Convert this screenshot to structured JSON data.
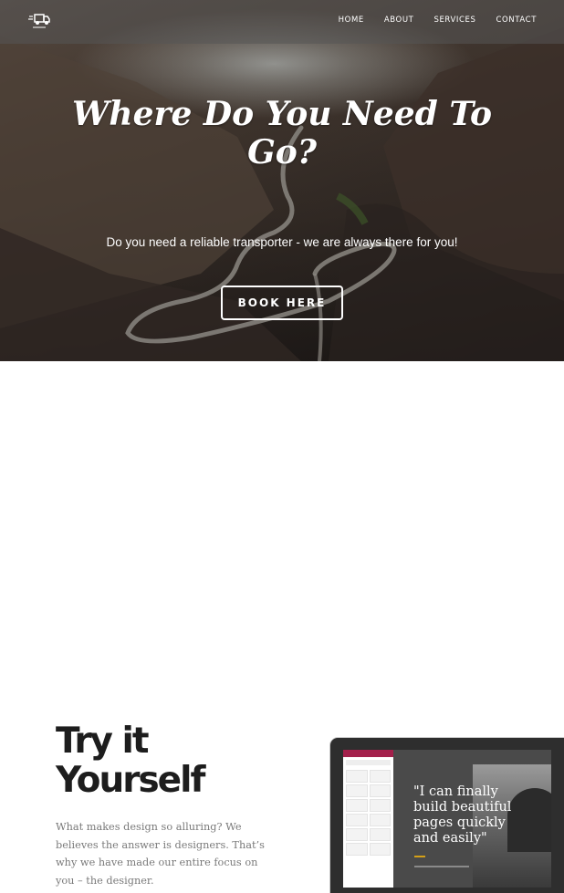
{
  "nav": {
    "logo_icon": "delivery-truck-icon",
    "items": [
      "HOME",
      "ABOUT",
      "SERVICES",
      "CONTACT"
    ]
  },
  "hero": {
    "title": "Where Do You Need To Go?",
    "subtitle": "Do you need a reliable transporter - we are always there for you!",
    "button": "BOOK HERE"
  },
  "feature": {
    "title_line1": "Try it",
    "title_line2": "Yourself",
    "text": "What makes design so alluring? We believes the answer is designers. That’s why we have made our entire focus on you – the designer.",
    "quote": "\"I can finally build beautiful pages quickly and easily\""
  },
  "colors": {
    "panel_accent": "#a3204b",
    "quote_rule": "#d4a017"
  }
}
